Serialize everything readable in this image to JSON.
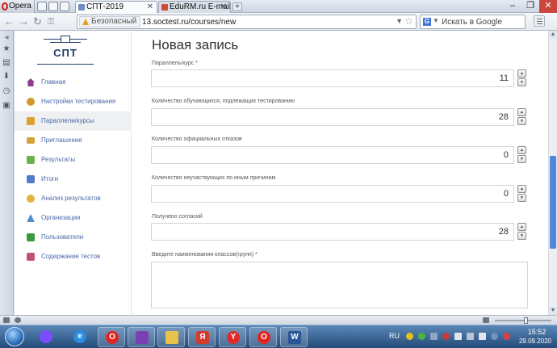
{
  "browser": {
    "menu_label": "Opera",
    "tabs": [
      {
        "label": "СПТ-2019",
        "active": true
      },
      {
        "label": "EduRM.ru E-mail :...",
        "active": false
      }
    ],
    "new_tab_label": "+",
    "address": {
      "security_label": "Безопасный",
      "url": "13.soctest.ru/courses/new"
    },
    "search": {
      "placeholder": "Искать в Google",
      "engine_icon": "G"
    }
  },
  "logo": {
    "text": "СПТ"
  },
  "sidebar": {
    "items": [
      {
        "label": "Главная",
        "icon": "home-icon",
        "color": "#8e3a8a"
      },
      {
        "label": "Настройки тестирования",
        "icon": "settings-icon",
        "color": "#d09a2a"
      },
      {
        "label": "Параллели/курсы",
        "icon": "folder-icon",
        "color": "#e0a030"
      },
      {
        "label": "Приглашения",
        "icon": "envelope-icon",
        "color": "#d4a33a"
      },
      {
        "label": "Результаты",
        "icon": "results-icon",
        "color": "#6fb14a"
      },
      {
        "label": "Итоги",
        "icon": "summary-icon",
        "color": "#4f7cc4"
      },
      {
        "label": "Анализ результатов",
        "icon": "analysis-icon",
        "color": "#e3b33c"
      },
      {
        "label": "Организации",
        "icon": "organization-icon",
        "color": "#4f8fd0"
      },
      {
        "label": "Пользователи",
        "icon": "users-icon",
        "color": "#3a9a3a"
      },
      {
        "label": "Содержание тестов",
        "icon": "tests-icon",
        "color": "#c0507a"
      }
    ],
    "active_index": 2
  },
  "form": {
    "title": "Новая запись",
    "fields": [
      {
        "label": "Параллель/курс *",
        "value": "11"
      },
      {
        "label": "Количество обучающихся, подлежащих тестированию",
        "value": "28"
      },
      {
        "label": "Количество официальных отказов",
        "value": "0"
      },
      {
        "label": "Количество неучаствующих по иным причинам",
        "value": "0"
      },
      {
        "label": "Получено согласий",
        "value": "28"
      }
    ],
    "classes_label": "Введите наименования классов(групп) *",
    "classes_value": ""
  },
  "spinner": {
    "up": "▲",
    "down": "▼"
  },
  "taskbar": {
    "lang": "RU",
    "time": "15:52",
    "date": "29.09.2020",
    "apps": [
      {
        "name": "alice-app-icon",
        "glyph": "",
        "color": "#7b4dff"
      },
      {
        "name": "ie-app-icon",
        "glyph": "e",
        "color": "#2a8de0"
      },
      {
        "name": "opera-app-icon",
        "glyph": "O",
        "color": "#e0241f"
      },
      {
        "name": "visual-studio-app-icon",
        "glyph": "",
        "color": "#7a3fb0"
      },
      {
        "name": "explorer-app-icon",
        "glyph": "",
        "color": "#e8c24a"
      },
      {
        "name": "yandex-app-icon",
        "glyph": "Я",
        "color": "#d63a2a"
      },
      {
        "name": "yandex-browser-app-icon",
        "glyph": "Y",
        "color": "#e02a2a"
      },
      {
        "name": "opera-window-app-icon",
        "glyph": "O",
        "color": "#e0241f"
      },
      {
        "name": "word-app-icon",
        "glyph": "W",
        "color": "#2b579a"
      }
    ]
  }
}
